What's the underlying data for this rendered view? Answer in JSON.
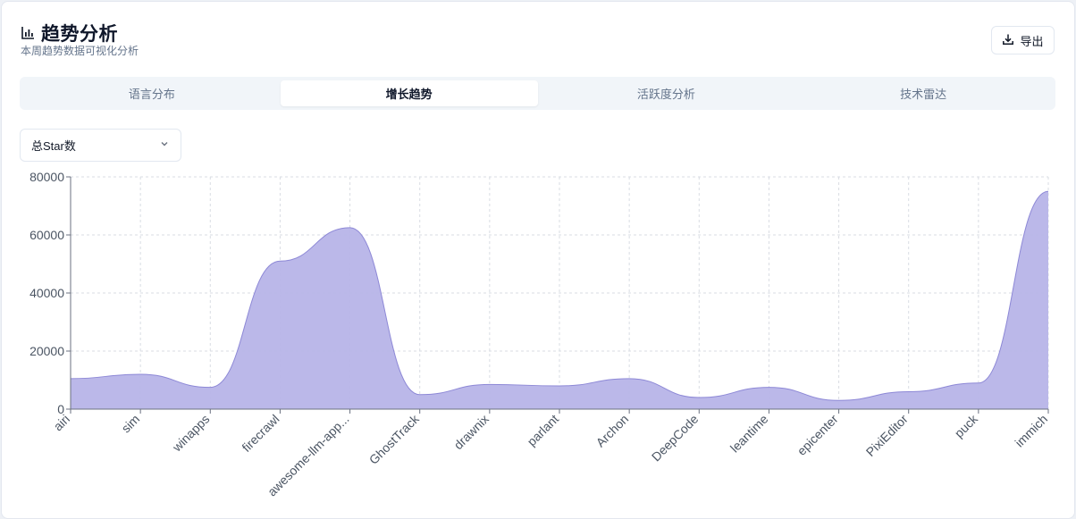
{
  "header": {
    "title": "趋势分析",
    "subtitle": "本周趋势数据可视化分析",
    "title_icon": "bar-chart-icon",
    "export_label": "导出",
    "export_icon": "download-icon"
  },
  "tabs": [
    {
      "label": "语言分布",
      "active": false
    },
    {
      "label": "增长趋势",
      "active": true
    },
    {
      "label": "活跃度分析",
      "active": false
    },
    {
      "label": "技术雷达",
      "active": false
    }
  ],
  "metric_select": {
    "value": "总Star数",
    "icon": "chevron-down-icon"
  },
  "colors": {
    "area_fill": "#b7b4e8",
    "area_stroke": "#8d88d6",
    "grid": "#d9dde3",
    "axis": "#6b7280"
  },
  "chart_data": {
    "type": "area",
    "categories": [
      "airi",
      "sim",
      "winapps",
      "firecrawl",
      "awesome-llm-app...",
      "GhostTrack",
      "drawnix",
      "parlant",
      "Archon",
      "DeepCode",
      "leantime",
      "epicenter",
      "PixiEditor",
      "puck",
      "immich"
    ],
    "values": [
      10500,
      12000,
      7500,
      51000,
      62500,
      5000,
      8500,
      8000,
      10500,
      4000,
      7500,
      3000,
      6000,
      9000,
      75000
    ],
    "ylim": [
      0,
      80000
    ],
    "yticks": [
      "0",
      "20000",
      "40000",
      "60000",
      "80000"
    ],
    "grid": true,
    "title": "",
    "xlabel": "",
    "ylabel": ""
  }
}
